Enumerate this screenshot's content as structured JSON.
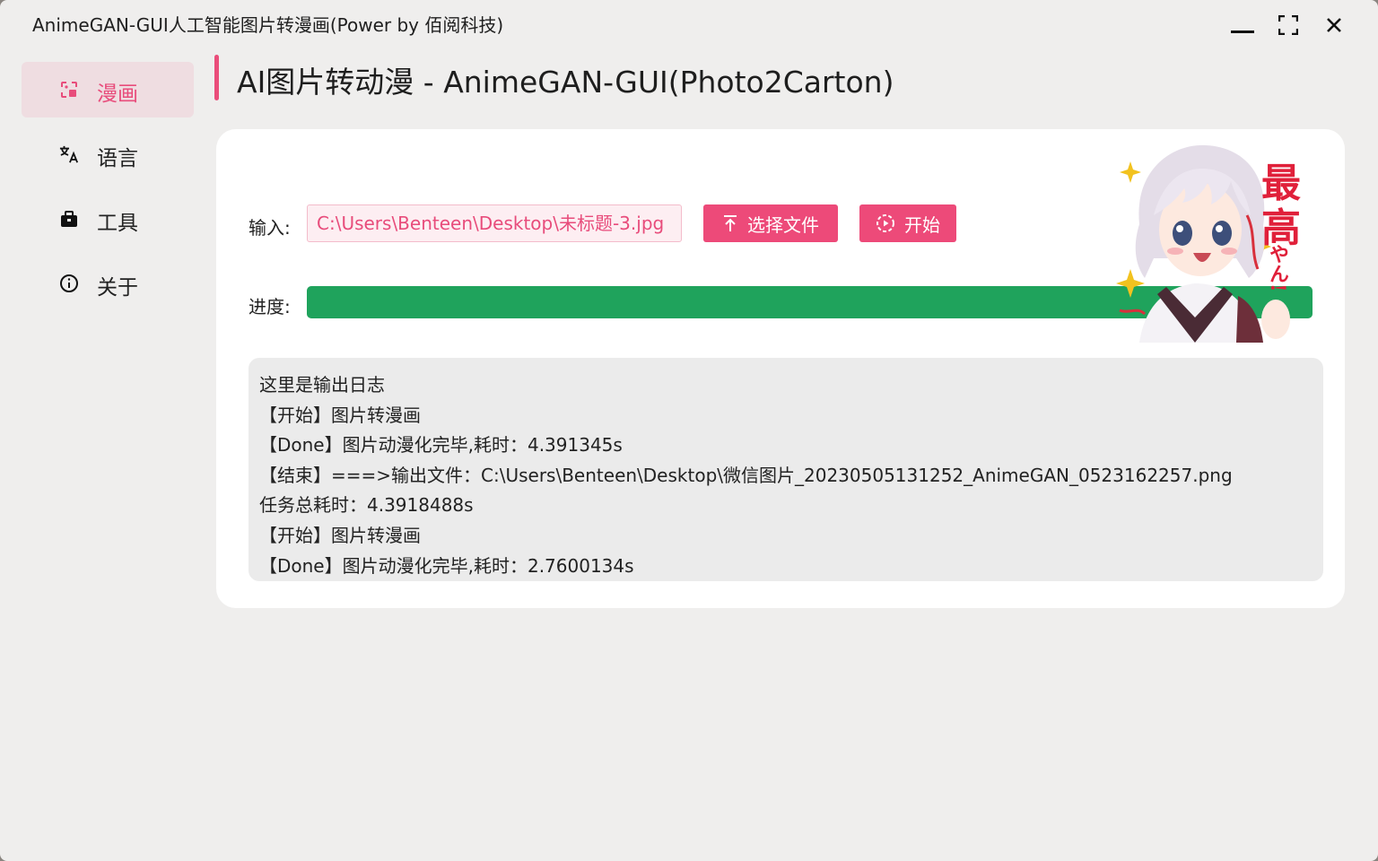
{
  "window": {
    "title": "AnimeGAN-GUI人工智能图片转漫画(Power by 佰阅科技)"
  },
  "sidebar": {
    "items": [
      {
        "label": "漫画",
        "icon": "image-edit-icon",
        "active": true
      },
      {
        "label": "语言",
        "icon": "translate-icon",
        "active": false
      },
      {
        "label": "工具",
        "icon": "toolbox-icon",
        "active": false
      },
      {
        "label": "关于",
        "icon": "info-icon",
        "active": false
      }
    ]
  },
  "page": {
    "title": "AI图片转动漫 - AnimeGAN-GUI(Photo2Carton)"
  },
  "form": {
    "input_label": "输入:",
    "input_path": "C:\\Users\\Benteen\\Desktop\\未标题-3.jpg",
    "select_button": "选择文件",
    "start_button": "开始",
    "progress_label": "进度:",
    "progress_percent": 100
  },
  "mascot": {
    "caption_line1": "最",
    "caption_line2": "高",
    "caption_line3": "やん!"
  },
  "log": {
    "lines": [
      "这里是输出日志",
      "【开始】图片转漫画",
      "【Done】图片动漫化完毕,耗时：4.391345s",
      "【结束】===>输出文件：C:\\Users\\Benteen\\Desktop\\微信图片_20230505131252_AnimeGAN_0523162257.png",
      "任务总耗时：4.3918488s",
      "【开始】图片转漫画",
      "【Done】图片动漫化完毕,耗时：2.7600134s"
    ]
  },
  "colors": {
    "accent": "#ea4d7a",
    "progress": "#1fa35c",
    "window_bg": "#efeeed"
  }
}
